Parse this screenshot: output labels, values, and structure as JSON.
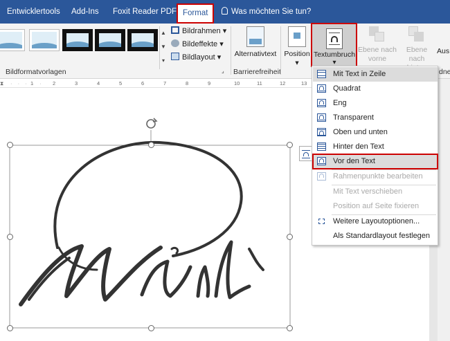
{
  "tabs": [
    "Entwicklertools",
    "Add-Ins",
    "Foxit Reader PDF",
    "Format"
  ],
  "tell_me": "Was möchten Sie tun?",
  "ribbon": {
    "picture_styles_label": "Bildformatvorlagen",
    "bildrahmen": "Bildrahmen",
    "bildeffekte": "Bildeffekte",
    "bildlayout": "Bildlayout",
    "alternativtext": "Alternativtext",
    "barrierefreiheit_label": "Barrierefreiheit",
    "position": "Position",
    "textumbruch": "Textumbruch",
    "ebene_nach_vorne_1": "Ebene nach",
    "ebene_nach_vorne_2": "vorne",
    "ebene_nach_hinten_1": "Ebene nach",
    "ebene_nach_hinten_2": "hinten",
    "aus_cut": "Aus",
    "right_group_cut": "dne"
  },
  "ruler_marks": [
    "1",
    "2",
    "3",
    "4",
    "5",
    "6",
    "7",
    "8",
    "9",
    "10",
    "11",
    "12",
    "13"
  ],
  "menu": {
    "items": [
      {
        "label": "Mit Text in Zeile",
        "state": "highlighted"
      },
      {
        "label": "Quadrat",
        "state": "normal"
      },
      {
        "label": "Eng",
        "state": "normal"
      },
      {
        "label": "Transparent",
        "state": "normal"
      },
      {
        "label": "Oben und unten",
        "state": "normal"
      },
      {
        "label": "Hinter den Text",
        "state": "normal"
      },
      {
        "label": "Vor den Text",
        "state": "boxed"
      },
      {
        "label": "Rahmenpunkte bearbeiten",
        "state": "disabled"
      },
      {
        "label": "Mit Text verschieben",
        "state": "disabled"
      },
      {
        "label": "Position auf Seite fixieren",
        "state": "disabled"
      },
      {
        "label": "Weitere Layoutoptionen...",
        "state": "normal"
      },
      {
        "label": "Als Standardlayout festlegen",
        "state": "normal"
      }
    ]
  },
  "colors": {
    "ribbon_blue": "#2b579a",
    "highlight_red": "#cc0000"
  }
}
